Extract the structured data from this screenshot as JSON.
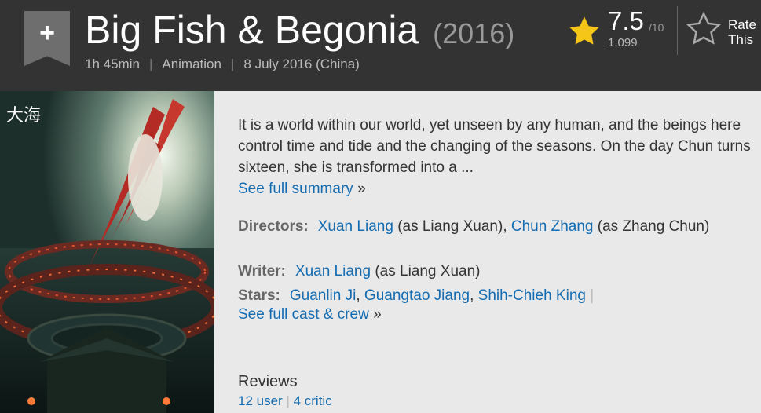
{
  "header": {
    "title": "Big Fish & Begonia",
    "year": "(2016)",
    "runtime": "1h 45min",
    "genre": "Animation",
    "release": "8 July 2016 (China)",
    "rating": "7.5",
    "rating_max": "/10",
    "rating_count": "1,099",
    "rate_label_line1": "Rate",
    "rate_label_line2": "This",
    "watchlist_icon": "plus-icon"
  },
  "poster": {
    "title_text": "大海"
  },
  "summary": {
    "text": "It is a world within our world, yet unseen by any human, and the beings here control time and tide and the changing of the seasons. On the day Chun turns sixteen, she is transformed into a ...",
    "link": "See full summary",
    "link_suffix": "»"
  },
  "credits": {
    "directors_label": "Directors:",
    "director1": "Xuan Liang",
    "director1_alias": "(as Liang Xuan),",
    "director2": "Chun Zhang",
    "director2_alias": "(as Zhang Chun)",
    "writer_label": "Writer:",
    "writer1": "Xuan Liang",
    "writer1_alias": "(as Liang Xuan)",
    "stars_label": "Stars:",
    "star1": "Guanlin Ji",
    "star2": "Guangtao Jiang",
    "star3": "Shih-Chieh King",
    "cast_link": "See full cast & crew",
    "cast_link_suffix": "»"
  },
  "reviews": {
    "title": "Reviews",
    "user_link": "12 user",
    "critic_link": "4 critic"
  },
  "colors": {
    "header_bg": "#333333",
    "link": "#136cb2",
    "star": "#f5c518"
  }
}
